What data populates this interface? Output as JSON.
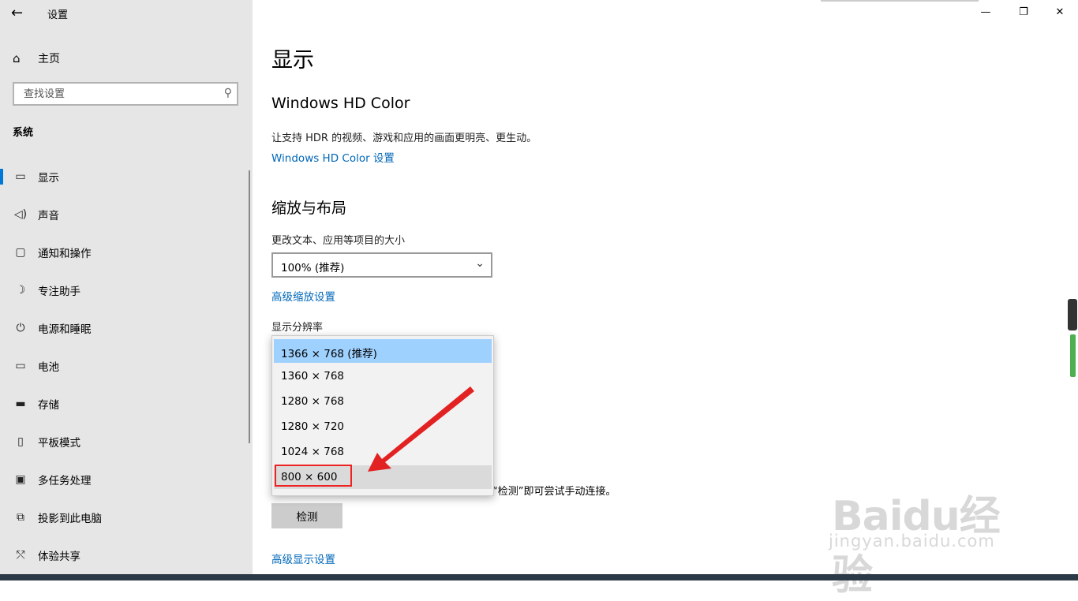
{
  "window": {
    "title": "设置",
    "back_icon": "arrow-left-icon"
  },
  "sidebar": {
    "home_label": "主页",
    "search_placeholder": "查找设置",
    "section_title": "系统",
    "items": [
      {
        "label": "显示",
        "icon": "monitor-icon",
        "active": true
      },
      {
        "label": "声音",
        "icon": "speaker-icon"
      },
      {
        "label": "通知和操作",
        "icon": "notification-icon"
      },
      {
        "label": "专注助手",
        "icon": "moon-icon"
      },
      {
        "label": "电源和睡眠",
        "icon": "power-icon"
      },
      {
        "label": "电池",
        "icon": "battery-icon"
      },
      {
        "label": "存储",
        "icon": "storage-icon"
      },
      {
        "label": "平板模式",
        "icon": "tablet-icon"
      },
      {
        "label": "多任务处理",
        "icon": "multitask-icon"
      },
      {
        "label": "投影到此电脑",
        "icon": "project-icon"
      },
      {
        "label": "体验共享",
        "icon": "share-icon"
      }
    ]
  },
  "main": {
    "page_title": "显示",
    "hd_color": {
      "heading": "Windows HD Color",
      "description": "让支持 HDR 的视频、游戏和应用的画面更明亮、更生动。",
      "link": "Windows HD Color 设置"
    },
    "scale_layout": {
      "heading": "缩放与布局",
      "scale_label": "更改文本、应用等项目的大小",
      "scale_value": "100% (推荐)",
      "advanced_scale_link": "高级缩放设置",
      "resolution_label": "显示分辨率"
    },
    "detect_hint": "“检测”即可尝试手动连接。",
    "detect_button": "检测",
    "advanced_display_link": "高级显示设置"
  },
  "resolution_dropdown": {
    "options": [
      "1366 × 768 (推荐)",
      "1360 × 768",
      "1280 × 768",
      "1280 × 720",
      "1024 × 768",
      "800 × 600"
    ],
    "selected_index": 0,
    "hover_index": 5
  },
  "annotation": {
    "color": "#e22222"
  },
  "watermark": {
    "brand": "Baidu经验",
    "url": "jingyan.baidu.com"
  }
}
